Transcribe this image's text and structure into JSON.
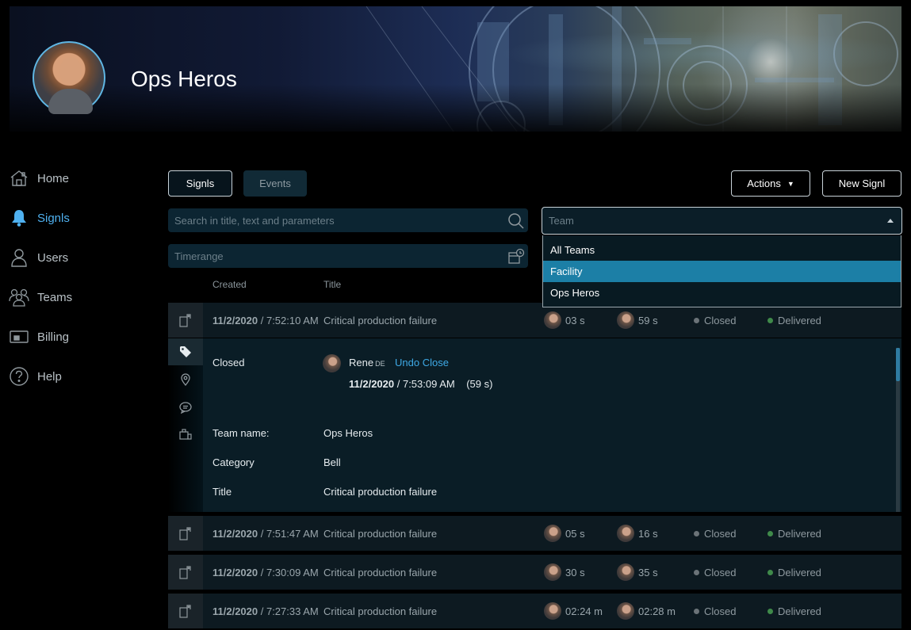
{
  "header": {
    "team_title": "Ops Heros"
  },
  "sidebar": {
    "items": [
      {
        "label": "Home",
        "icon": "home-icon",
        "active": false
      },
      {
        "label": "Signls",
        "icon": "bell-icon",
        "active": true
      },
      {
        "label": "Users",
        "icon": "user-icon",
        "active": false
      },
      {
        "label": "Teams",
        "icon": "team-icon",
        "active": false
      },
      {
        "label": "Billing",
        "icon": "wallet-icon",
        "active": false
      },
      {
        "label": "Help",
        "icon": "help-icon",
        "active": false
      }
    ]
  },
  "toolbar": {
    "tab_signls": "Signls",
    "tab_events": "Events",
    "actions_label": "Actions",
    "new_label": "New Signl"
  },
  "filters": {
    "search_placeholder": "Search in title, text and parameters",
    "timerange_placeholder": "Timerange",
    "team_placeholder": "Team",
    "team_options": [
      "All Teams",
      "Facility",
      "Ops Heros"
    ],
    "team_highlighted": "Facility"
  },
  "table": {
    "col_created": "Created",
    "col_title": "Title",
    "rows": [
      {
        "date": "11/2/2020",
        "time": " / 7:52:10 AM",
        "title": "Critical production failure",
        "dur1": "03 s",
        "dur2": "59 s",
        "status": "Closed",
        "delivery": "Delivered"
      },
      {
        "date": "11/2/2020",
        "time": " / 7:51:47 AM",
        "title": "Critical production failure",
        "dur1": "05 s",
        "dur2": "16 s",
        "status": "Closed",
        "delivery": "Delivered"
      },
      {
        "date": "11/2/2020",
        "time": " / 7:30:09 AM",
        "title": "Critical production failure",
        "dur1": "30 s",
        "dur2": "35 s",
        "status": "Closed",
        "delivery": "Delivered"
      },
      {
        "date": "11/2/2020",
        "time": " / 7:27:33 AM",
        "title": "Critical production failure",
        "dur1": "02:24 m",
        "dur2": "02:28 m",
        "status": "Closed",
        "delivery": "Delivered"
      }
    ]
  },
  "detail": {
    "state_label": "Closed",
    "user_name": "Rene",
    "user_locale": "DE",
    "undo_label": "Undo Close",
    "closed_date": "11/2/2020",
    "closed_time": " / 7:53:09 AM",
    "closed_elapsed": "(59 s)",
    "fields": [
      {
        "label": "Team name:",
        "value": "Ops Heros"
      },
      {
        "label": "Category",
        "value": "Bell"
      },
      {
        "label": "Title",
        "value": "Critical production failure"
      }
    ]
  },
  "colors": {
    "accent": "#4fb1f0",
    "selected_option": "#1c7fa6",
    "status_dot": "#6b7378",
    "delivered_dot": "#3f8a4a"
  }
}
